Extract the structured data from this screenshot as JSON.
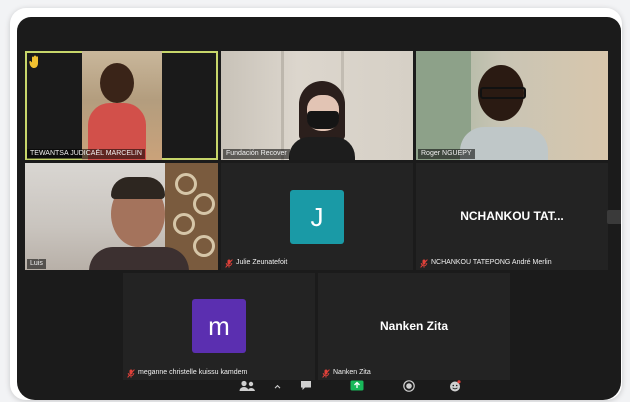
{
  "participants": [
    {
      "name": "TEWANTSA JUDICAËL MARCELIN",
      "type": "video",
      "raised_hand": true
    },
    {
      "name": "Fundación Recover",
      "type": "video"
    },
    {
      "name": "Roger NGUEPY",
      "type": "video"
    },
    {
      "name": "Luis",
      "type": "video"
    },
    {
      "name": "Julie Zeunatefoit",
      "type": "avatar",
      "initial": "J",
      "color": "#1a9aa6",
      "muted": true
    },
    {
      "name": "NCHANKOU TATEPONG André Merlin",
      "type": "name",
      "display": "NCHANKOU  TAT...",
      "muted": true
    },
    {
      "name": "meganne christelle kuissu kamdem",
      "type": "avatar",
      "initial": "m",
      "color": "#5b2fb0",
      "muted": true
    },
    {
      "name": "Nanken Zita",
      "type": "name",
      "display": "Nanken Zita",
      "muted": true
    }
  ],
  "colors": {
    "active_speaker": "#c7d66a",
    "mute": "#e0413a",
    "share": "#18b85a"
  },
  "toolbar": {
    "icons": [
      "participants-icon",
      "chevron-up-icon",
      "chat-icon",
      "share-screen-icon",
      "record-icon",
      "reactions-icon"
    ]
  }
}
